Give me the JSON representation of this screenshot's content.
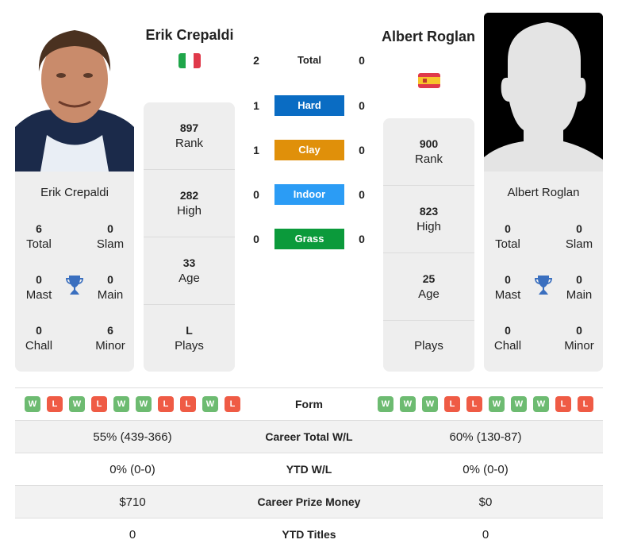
{
  "colors": {
    "hard": "#0a6cc3",
    "clay": "#e0900a",
    "indoor": "#2b9cf5",
    "grass": "#0b9a3b",
    "win": "#6dbb71",
    "loss": "#ef5b45",
    "trophy": "#3a6fbf"
  },
  "player1": {
    "name": "Erik Crepaldi",
    "country": "Italy",
    "flag_icon": "italy-flag-icon",
    "card_name": "Erik Crepaldi",
    "titles": {
      "total": {
        "value": "6",
        "label": "Total"
      },
      "slam": {
        "value": "0",
        "label": "Slam"
      },
      "mast": {
        "value": "0",
        "label": "Mast"
      },
      "main": {
        "value": "0",
        "label": "Main"
      },
      "chall": {
        "value": "0",
        "label": "Chall"
      },
      "minor": {
        "value": "6",
        "label": "Minor"
      }
    },
    "stats": [
      {
        "value": "897",
        "label": "Rank"
      },
      {
        "value": "282",
        "label": "High"
      },
      {
        "value": "33",
        "label": "Age"
      },
      {
        "value": "L",
        "label": "Plays"
      }
    ],
    "form": [
      "W",
      "L",
      "W",
      "L",
      "W",
      "W",
      "L",
      "L",
      "W",
      "L"
    ]
  },
  "player2": {
    "name": "Albert Roglan",
    "country": "Spain",
    "flag_icon": "spain-flag-icon",
    "card_name": "Albert Roglan",
    "titles": {
      "total": {
        "value": "0",
        "label": "Total"
      },
      "slam": {
        "value": "0",
        "label": "Slam"
      },
      "mast": {
        "value": "0",
        "label": "Mast"
      },
      "main": {
        "value": "0",
        "label": "Main"
      },
      "chall": {
        "value": "0",
        "label": "Chall"
      },
      "minor": {
        "value": "0",
        "label": "Minor"
      }
    },
    "stats": [
      {
        "value": "900",
        "label": "Rank"
      },
      {
        "value": "823",
        "label": "High"
      },
      {
        "value": "25",
        "label": "Age"
      },
      {
        "value": "",
        "label": "Plays"
      }
    ],
    "form": [
      "W",
      "W",
      "W",
      "L",
      "L",
      "W",
      "W",
      "W",
      "L",
      "L"
    ]
  },
  "h2h": [
    {
      "label": "Total",
      "p1": "2",
      "p2": "0"
    },
    {
      "label": "Hard",
      "p1": "1",
      "p2": "0"
    },
    {
      "label": "Clay",
      "p1": "1",
      "p2": "0"
    },
    {
      "label": "Indoor",
      "p1": "0",
      "p2": "0"
    },
    {
      "label": "Grass",
      "p1": "0",
      "p2": "0"
    }
  ],
  "table": {
    "form_label": "Form",
    "rows": [
      {
        "label": "Career Total W/L",
        "p1": "55% (439-366)",
        "p2": "60% (130-87)"
      },
      {
        "label": "YTD W/L",
        "p1": "0% (0-0)",
        "p2": "0% (0-0)"
      },
      {
        "label": "Career Prize Money",
        "p1": "$710",
        "p2": "$0"
      },
      {
        "label": "YTD Titles",
        "p1": "0",
        "p2": "0"
      }
    ]
  }
}
